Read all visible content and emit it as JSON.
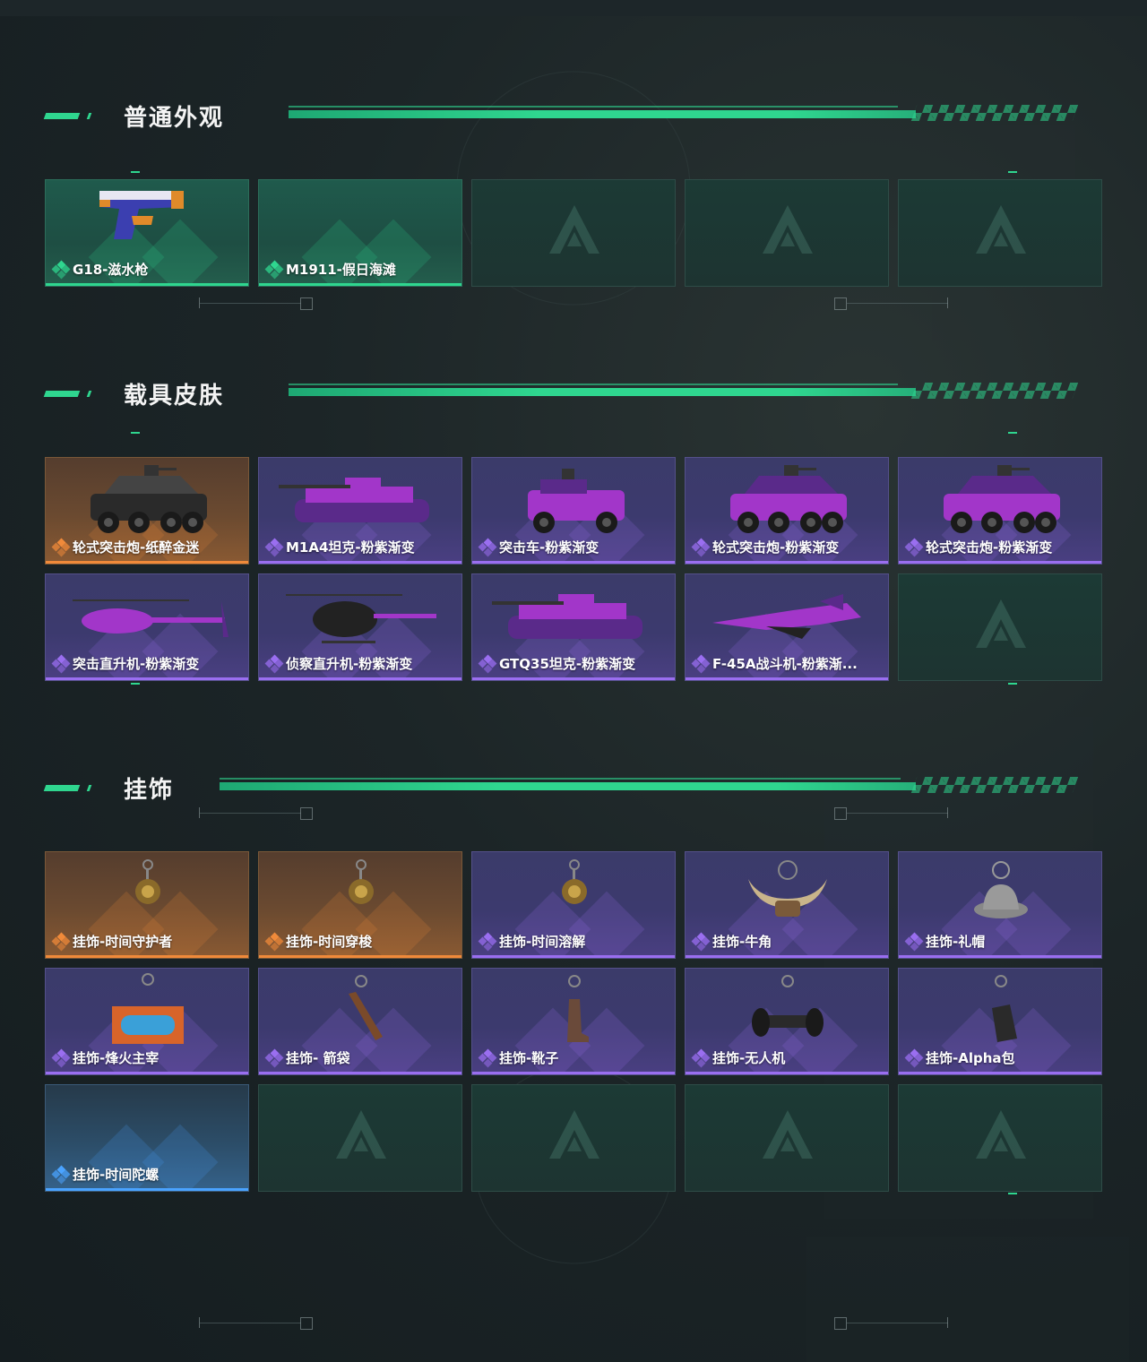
{
  "sections": [
    {
      "title": "普通外观",
      "items": [
        {
          "label": "G18-滋水枪",
          "rarity": "green",
          "icon": "pistol-image"
        },
        {
          "label": "M1911-假日海滩",
          "rarity": "green",
          "icon": "empty-image"
        },
        {
          "label": "",
          "rarity": "empty",
          "icon": "placeholder-emblem-icon"
        },
        {
          "label": "",
          "rarity": "empty",
          "icon": "placeholder-emblem-icon"
        },
        {
          "label": "",
          "rarity": "empty",
          "icon": "placeholder-emblem-icon"
        }
      ]
    },
    {
      "title": "载具皮肤",
      "items": [
        {
          "label": "轮式突击炮-纸醉金迷",
          "rarity": "orange",
          "icon": "armored-car-image"
        },
        {
          "label": "M1A4坦克-粉紫渐变",
          "rarity": "purple",
          "icon": "tank-image"
        },
        {
          "label": "突击车-粉紫渐变",
          "rarity": "purple",
          "icon": "assault-vehicle-image"
        },
        {
          "label": "轮式突击炮-粉紫渐变",
          "rarity": "purple",
          "icon": "armored-car-image"
        },
        {
          "label": "轮式突击炮-粉紫渐变",
          "rarity": "purple",
          "icon": "armored-car-image"
        },
        {
          "label": "突击直升机-粉紫渐变",
          "rarity": "purple",
          "icon": "attack-helicopter-image"
        },
        {
          "label": "侦察直升机-粉紫渐变",
          "rarity": "purple",
          "icon": "scout-helicopter-image"
        },
        {
          "label": "GTQ35坦克-粉紫渐变",
          "rarity": "purple",
          "icon": "tank-image"
        },
        {
          "label": "F-45A战斗机-粉紫渐...",
          "rarity": "purple",
          "icon": "fighter-jet-image"
        },
        {
          "label": "",
          "rarity": "empty",
          "icon": "placeholder-emblem-icon"
        }
      ]
    },
    {
      "title": "挂饰",
      "items": [
        {
          "label": "挂饰-时间守护者",
          "rarity": "orange",
          "icon": "charm-image"
        },
        {
          "label": "挂饰-时间穿梭",
          "rarity": "orange",
          "icon": "charm-image"
        },
        {
          "label": "挂饰-时间溶解",
          "rarity": "purple",
          "icon": "charm-image"
        },
        {
          "label": "挂饰-牛角",
          "rarity": "purple",
          "icon": "horns-charm-image"
        },
        {
          "label": "挂饰-礼帽",
          "rarity": "purple",
          "icon": "hat-charm-image"
        },
        {
          "label": "挂饰-烽火主宰",
          "rarity": "purple",
          "icon": "container-charm-image"
        },
        {
          "label": "挂饰- 箭袋",
          "rarity": "purple",
          "icon": "quiver-charm-image"
        },
        {
          "label": "挂饰-靴子",
          "rarity": "purple",
          "icon": "boot-charm-image"
        },
        {
          "label": "挂饰-无人机",
          "rarity": "purple",
          "icon": "drone-charm-image"
        },
        {
          "label": "挂饰-Alpha包",
          "rarity": "purple",
          "icon": "bag-charm-image"
        },
        {
          "label": "挂饰-时间陀螺",
          "rarity": "blue",
          "icon": "empty-image"
        },
        {
          "label": "",
          "rarity": "empty",
          "icon": "placeholder-emblem-icon"
        },
        {
          "label": "",
          "rarity": "empty",
          "icon": "placeholder-emblem-icon"
        },
        {
          "label": "",
          "rarity": "empty",
          "icon": "placeholder-emblem-icon"
        },
        {
          "label": "",
          "rarity": "empty",
          "icon": "placeholder-emblem-icon"
        }
      ]
    }
  ],
  "colors": {
    "accent": "#2fd68f",
    "green": "#2fd68f",
    "purple": "#9a6ef0",
    "orange": "#f08a3a",
    "blue": "#4aa3ff"
  }
}
